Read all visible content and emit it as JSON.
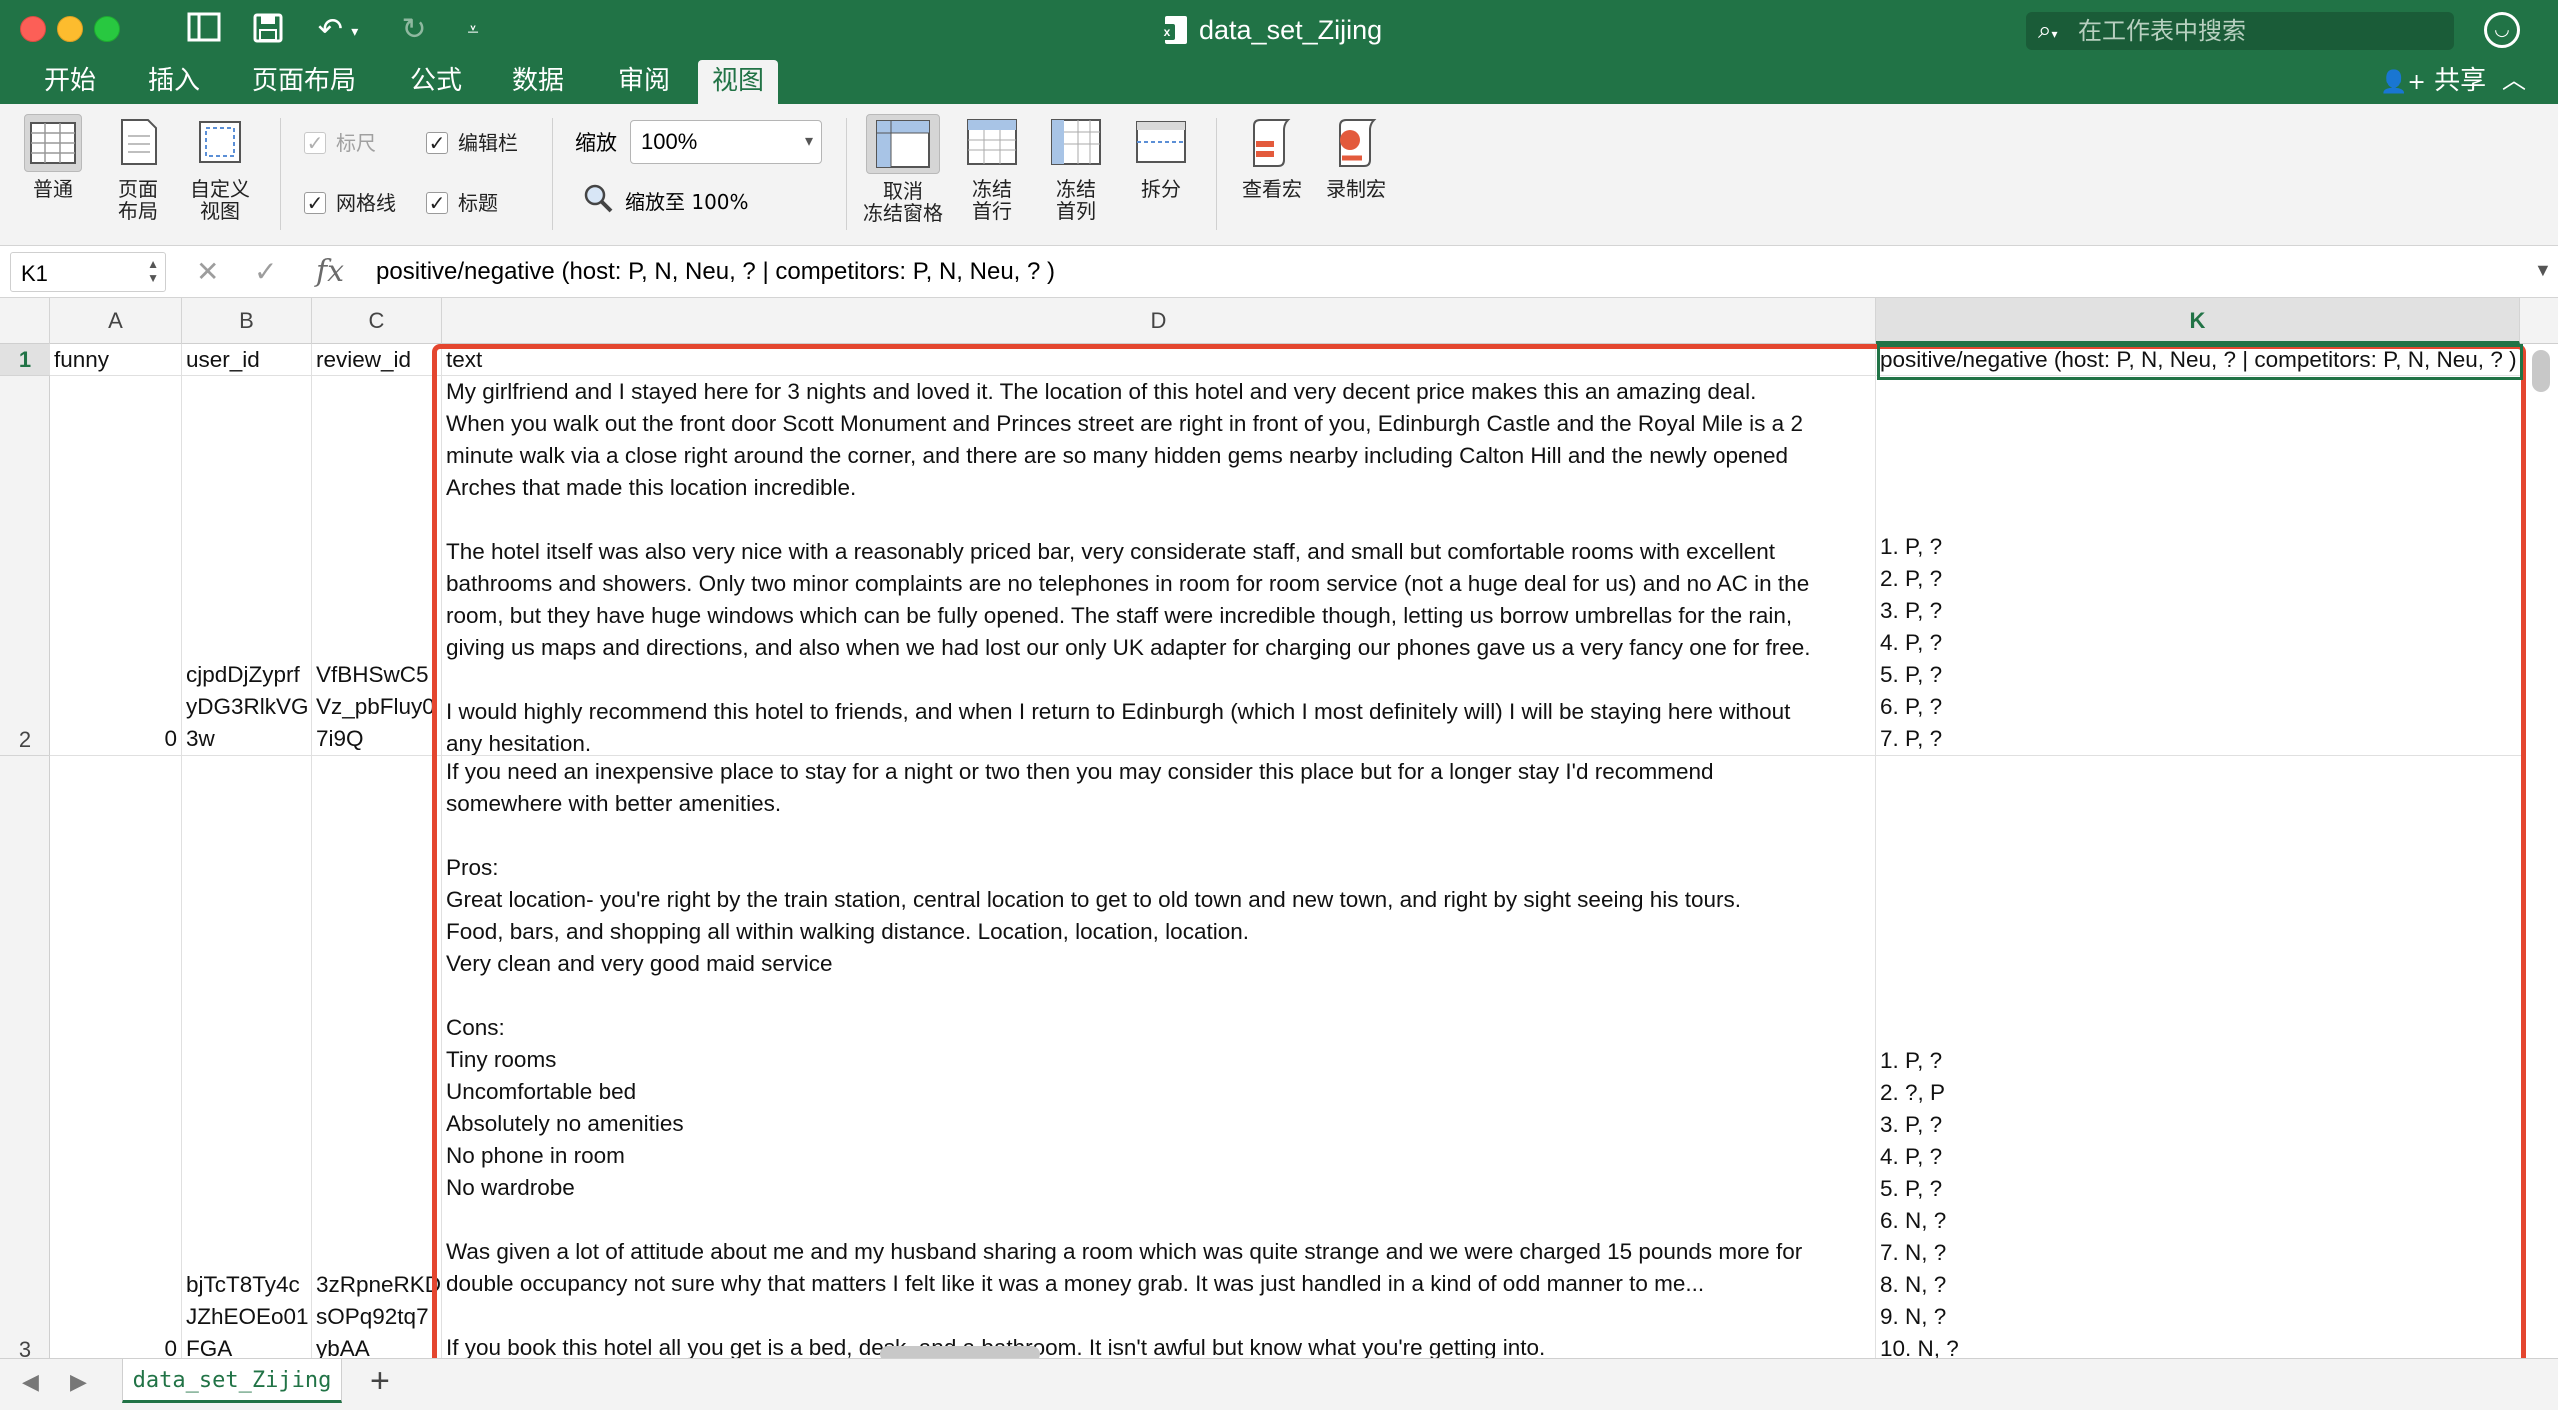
{
  "window": {
    "title": "data_set_Zijing",
    "search_placeholder": "在工作表中搜索"
  },
  "ribbon": {
    "tabs": [
      "开始",
      "插入",
      "页面布局",
      "公式",
      "数据",
      "审阅",
      "视图"
    ],
    "active_tab": "视图",
    "share_label": "共享",
    "views": {
      "normal": "普通",
      "page_layout_1": "页面",
      "page_layout_2": "布局",
      "custom_view_1": "自定义",
      "custom_view_2": "视图"
    },
    "show": {
      "ruler": "标尺",
      "formula_bar": "编辑栏",
      "gridlines": "网格线",
      "headings": "标题"
    },
    "zoom": {
      "label": "缩放",
      "value": "100%",
      "fit_label": "缩放至 100%"
    },
    "freeze": {
      "unfreeze_1": "取消",
      "unfreeze_2": "冻结窗格",
      "top_row_1": "冻结",
      "top_row_2": "首行",
      "first_col_1": "冻结",
      "first_col_2": "首列",
      "split": "拆分"
    },
    "macros": {
      "view": "查看宏",
      "record": "录制宏"
    }
  },
  "formula_bar": {
    "name_box": "K1",
    "formula": "positive/negative  (host: P, N, Neu, ? | competitors: P, N, Neu, ? )"
  },
  "grid": {
    "columns": [
      "A",
      "B",
      "C",
      "D",
      "K"
    ],
    "selected_column": "K",
    "rows": [
      "1",
      "2",
      "3"
    ],
    "headers": {
      "A": "funny",
      "B": "user_id",
      "C": "review_id",
      "D": "text",
      "K": "positive/negative  (host: P, N, Neu, ? | competitors: P, N, Neu, ? )"
    },
    "row2": {
      "A": "0",
      "B": [
        "cjpdDjZyprf",
        "yDG3RlkVG",
        "3w"
      ],
      "C": [
        "VfBHSwC5",
        "Vz_pbFluy0",
        "7i9Q"
      ],
      "D": [
        "My girlfriend and I stayed here for 3 nights and loved it. The location of this hotel and very decent price makes this an amazing deal.",
        "When you walk out the front door Scott Monument and Princes street are right in front of you, Edinburgh Castle and the Royal Mile is a 2",
        "minute walk via a close right around the corner, and there are so many hidden gems nearby including Calton Hill and the newly opened",
        "Arches that made this location incredible.",
        "",
        "The hotel itself was also very nice with a reasonably priced bar, very considerate staff, and small but comfortable rooms with excellent",
        "bathrooms and showers. Only two minor complaints are no telephones in room for room service (not a huge deal for us) and no AC in the",
        "room, but they have huge windows which can be fully opened. The staff were incredible though, letting us borrow umbrellas for the rain,",
        "giving us maps and directions, and also when we had lost our only UK adapter for charging our phones gave us a very fancy one for free.",
        "",
        "I would highly recommend this hotel to friends, and when I return to Edinburgh (which I most definitely will) I will be staying here without",
        "any hesitation."
      ],
      "K": [
        "1. P, ?",
        "2. P, ?",
        "3. P, ?",
        "4. P, ?",
        "5. P, ?",
        "6. P, ?",
        "7. P, ?"
      ]
    },
    "row3": {
      "A": "0",
      "B": [
        "bjTcT8Ty4c",
        "JZhEOEo01",
        "FGA"
      ],
      "C": [
        "3zRpneRKD",
        "sOPq92tq7",
        "ybAA"
      ],
      "D": [
        "If you need an inexpensive place to stay for a night or two then you may consider this place but for a longer stay I'd recommend",
        "somewhere with better amenities.",
        "",
        "Pros:",
        "Great location- you're right by the train station, central location to get to old town and new town, and right by sight seeing his tours.",
        "Food, bars, and shopping all within walking distance. Location, location, location.",
        "Very clean and very good maid service",
        "",
        "Cons:",
        "Tiny rooms",
        "Uncomfortable bed",
        "Absolutely no amenities",
        "No phone in room",
        "No wardrobe",
        "",
        "Was given a lot of attitude about me and my husband sharing a room which was quite strange and we were charged 15 pounds more for",
        "double occupancy not sure why that matters I felt like it was a money grab. It was just handled in a kind of odd manner to me...",
        "",
        "If you book this hotel all you get is a bed, desk, and a bathroom. It isn't awful but know what you're getting into."
      ],
      "K": [
        "1. P, ?",
        "2. ?, P",
        "3. P, ?",
        "4. P, ?",
        "5. P, ?",
        "6. N, ?",
        "7. N, ?",
        "8. N, ?",
        "9. N, ?",
        "10. N, ?"
      ]
    }
  },
  "sheets": {
    "tabs": [
      "data_set_Zijing"
    ],
    "active": "data_set_Zijing"
  },
  "colors": {
    "excel_green": "#217346",
    "highlight_red": "#e4462f"
  }
}
